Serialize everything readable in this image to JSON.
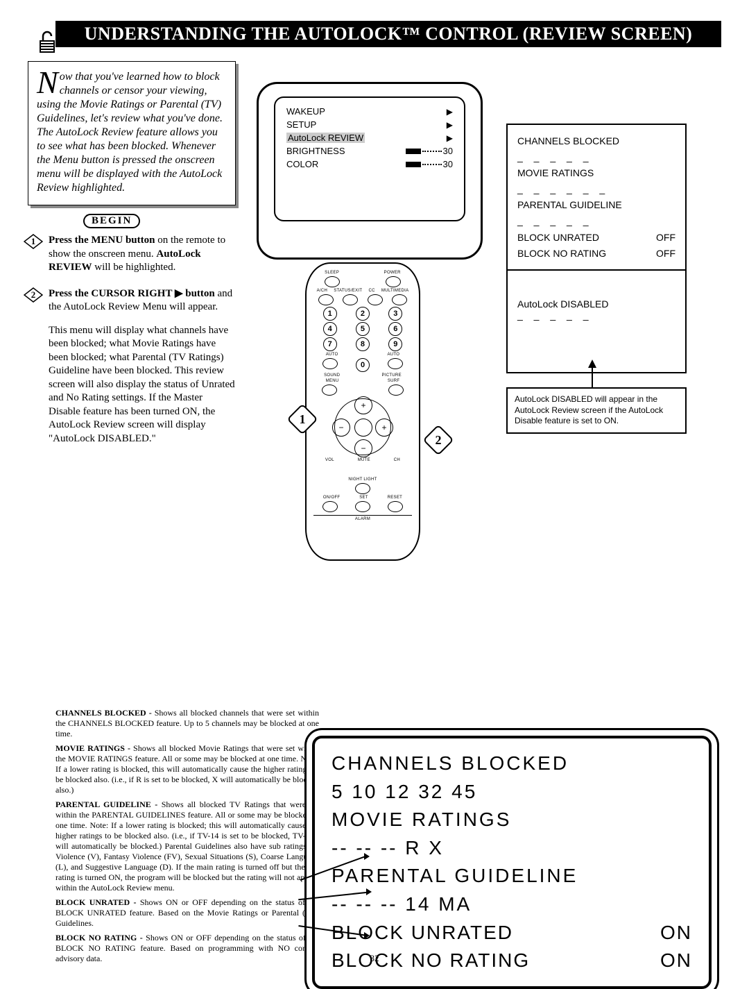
{
  "title": "UNDERSTANDING THE AUTOLOCK™ CONTROL (REVIEW SCREEN)",
  "page_number": "32",
  "intro": {
    "dropcap": "N",
    "text": "ow that you've learned how to block channels or censor your viewing, using the Movie Ratings or Parental (TV) Guidelines, let's review what you've done. The AutoLock Review feature allows you to see what has been blocked. Whenever the Menu button is pressed the onscreen menu will be displayed with the AutoLock Review highlighted."
  },
  "begin_label": "BEGIN",
  "steps": [
    {
      "num": "1",
      "bold1": "Press the MENU button",
      "after1": " on the remote to show the onscreen menu. ",
      "bold2": "AutoLock REVIEW",
      "after2": " will be highlighted."
    },
    {
      "num": "2",
      "bold1": "Press the CURSOR RIGHT ▶ button",
      "after1": " and the AutoLock Review Menu will appear.",
      "para2": "This menu will display what channels have been blocked; what Movie Ratings have been blocked; what Parental (TV Ratings) Guideline have been blocked. This review screen will also display the status of Unrated and No Rating settings. If the Master Disable feature has been turned ON, the AutoLock Review screen will display \"AutoLock DISABLED.\""
    }
  ],
  "osd": {
    "wakeup": "WAKEUP",
    "setup": "SETUP",
    "autolock": "AutoLock REVIEW",
    "brightness": "BRIGHTNESS",
    "brightness_val": "30",
    "color": "COLOR",
    "color_val": "30"
  },
  "review_box": {
    "channels": "CHANNELS BLOCKED",
    "dashes5": "_  _  _  _  _",
    "movie": "MOVIE RATINGS",
    "dashes6": "_  _  _  _  _  _",
    "parental": "PARENTAL GUIDELINE",
    "block_unrated": "BLOCK UNRATED",
    "block_unrated_val": "OFF",
    "block_norating": "BLOCK NO RATING",
    "block_norating_val": "OFF"
  },
  "disabled_box": {
    "text": "AutoLock DISABLED",
    "dashes": "_  _  _  _  _"
  },
  "note_box": "AutoLock DISABLED will appear in the AutoLock Review screen if the AutoLock Disable feature is set to ON.",
  "big_review": {
    "channels_label": "CHANNELS BLOCKED",
    "channels_values": "5  10  12  32  45",
    "movie_label": "MOVIE RATINGS",
    "movie_values": "--  --  --  R  X",
    "parental_label": "PARENTAL GUIDELINE",
    "parental_values": "--  --  --  14  MA",
    "block_unrated": "BLOCK UNRATED",
    "block_unrated_val": "ON",
    "block_norating": "BLOCK NO RATING",
    "block_norating_val": "ON"
  },
  "descriptions": {
    "channels": "CHANNELS BLOCKED - ",
    "channels_body": "Shows all blocked channels that were set within the CHANNELS BLOCKED feature. Up to 5 channels may be blocked at one time.",
    "movie": "MOVIE RATINGS - ",
    "movie_body": "Shows all blocked Movie Ratings that were set within the MOVIE RATINGS feature. All or some may be blocked at one time. Note: If a lower rating is blocked, this will automatically cause the higher ratings to be blocked also. (i.e., if R is set to be blocked, X will automatically be blocked also.)",
    "parental": "PARENTAL GUIDELINE - ",
    "parental_body": "Shows all blocked TV Ratings that were set within the PARENTAL GUIDELINES feature. All or some may be blocked at one time. Note: If a lower rating is blocked; this will automatically cause the higher ratings to be blocked also. (i.e., if TV-14 is set to be blocked, TV-MA will automatically be blocked.) Parental Guidelines also have sub ratings for Violence (V), Fantasy Violence (FV), Sexual Situations (S), Coarse Language (L), and Suggestive Language (D). If the main rating is turned off but the sub rating is turned ON, the program will be blocked but the rating will not appear within the AutoLock Review menu.",
    "unrated": "BLOCK UNRATED - ",
    "unrated_body": "Shows ON or OFF depending on the status of the BLOCK UNRATED feature. Based on the Movie Ratings or Parental (TV) Guidelines.",
    "norating": "BLOCK NO RATING - ",
    "norating_body": "Shows ON or OFF depending on the status of the BLOCK NO RATING feature. Based on programming with NO content advisory data."
  },
  "remote": {
    "sleep": "SLEEP",
    "power": "POWER",
    "ach": "A/CH",
    "status": "STATUS/EXIT",
    "cc": "CC",
    "multimedia": "MULTIMEDIA",
    "auto1": "AUTO",
    "auto2": "AUTO",
    "sound": "SOUND",
    "picture": "PICTURE",
    "menu": "MENU",
    "surf": "SURF",
    "vol": "VOL",
    "ch": "CH",
    "mute": "MUTE",
    "night": "NIGHT LIGHT",
    "onoff": "ON/OFF",
    "set": "SET",
    "reset": "RESET",
    "alarm": "ALARM"
  }
}
